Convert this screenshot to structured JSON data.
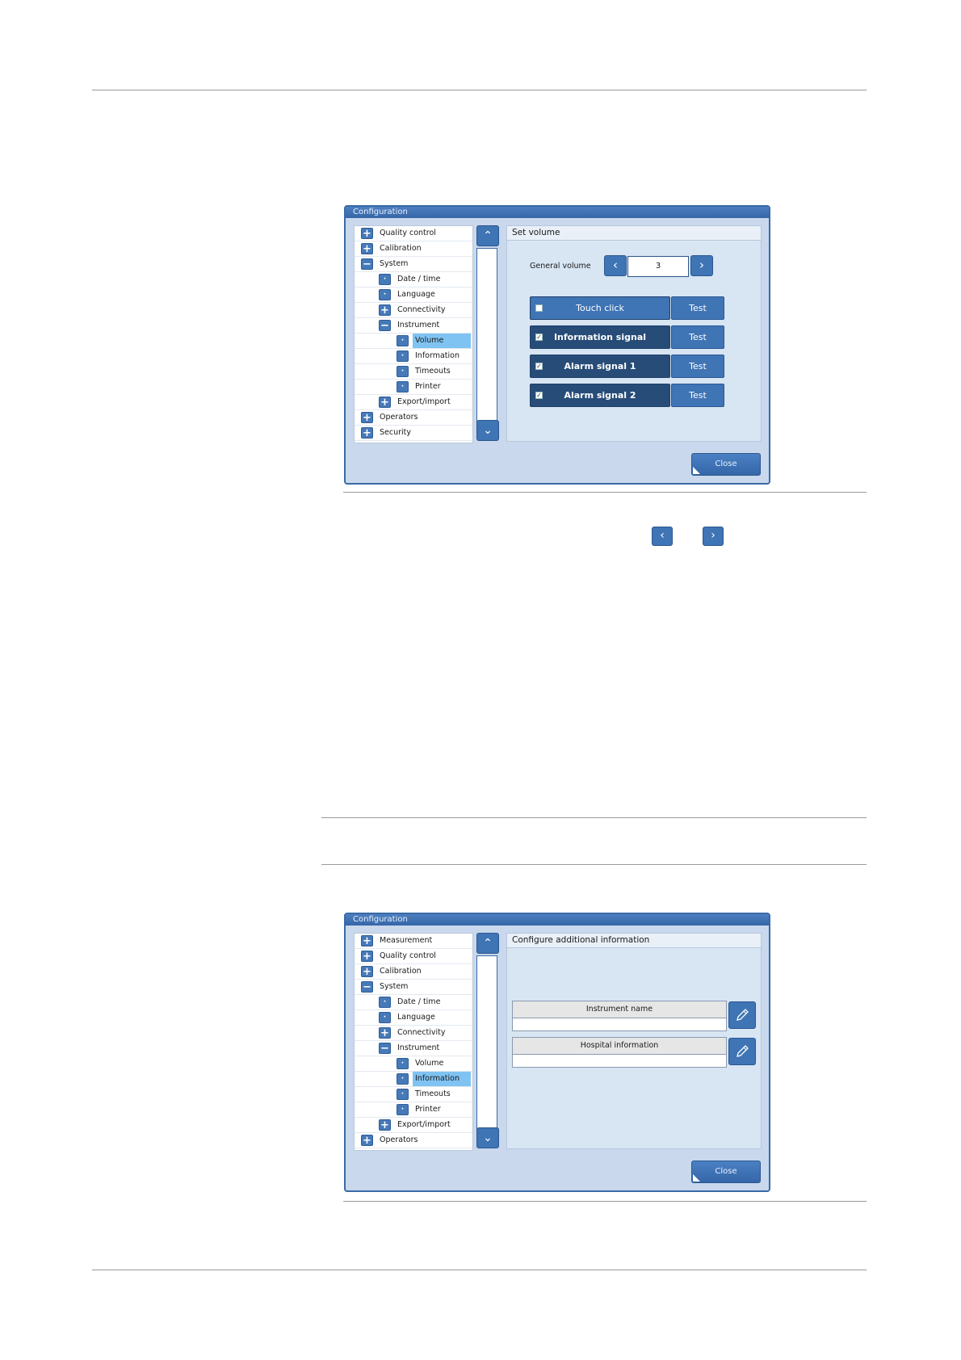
{
  "dialog1": {
    "title": "Configuration",
    "tree": [
      {
        "label": "Quality control",
        "icon": "plus-icon",
        "level": 0,
        "selected": false
      },
      {
        "label": "Calibration",
        "icon": "plus-icon",
        "level": 0,
        "selected": false
      },
      {
        "label": "System",
        "icon": "minus-icon",
        "level": 0,
        "selected": false
      },
      {
        "label": "Date / time",
        "icon": "dot-icon",
        "level": 1,
        "selected": false
      },
      {
        "label": "Language",
        "icon": "dot-icon",
        "level": 1,
        "selected": false
      },
      {
        "label": "Connectivity",
        "icon": "plus-icon",
        "level": 1,
        "selected": false
      },
      {
        "label": "Instrument",
        "icon": "minus-icon",
        "level": 1,
        "selected": false
      },
      {
        "label": "Volume",
        "icon": "dot-icon",
        "level": 2,
        "selected": true
      },
      {
        "label": "Information",
        "icon": "dot-icon",
        "level": 2,
        "selected": false
      },
      {
        "label": "Timeouts",
        "icon": "dot-icon",
        "level": 2,
        "selected": false
      },
      {
        "label": "Printer",
        "icon": "dot-icon",
        "level": 2,
        "selected": false
      },
      {
        "label": "Export/import",
        "icon": "plus-icon",
        "level": 1,
        "selected": false
      },
      {
        "label": "Operators",
        "icon": "plus-icon",
        "level": 0,
        "selected": false
      },
      {
        "label": "Security",
        "icon": "plus-icon",
        "level": 0,
        "selected": false
      }
    ],
    "panel_title": "Set volume",
    "general_volume_label": "General volume",
    "general_volume_value": "3",
    "signals": [
      {
        "label": "Touch click",
        "checked": false,
        "test_label": "Test"
      },
      {
        "label": "Information signal",
        "checked": true,
        "test_label": "Test"
      },
      {
        "label": "Alarm signal 1",
        "checked": true,
        "test_label": "Test"
      },
      {
        "label": "Alarm signal 2",
        "checked": true,
        "test_label": "Test"
      }
    ],
    "close_label": "Close"
  },
  "dialog2": {
    "title": "Configuration",
    "tree": [
      {
        "label": "Measurement",
        "icon": "plus-icon",
        "level": 0,
        "selected": false
      },
      {
        "label": "Quality control",
        "icon": "plus-icon",
        "level": 0,
        "selected": false
      },
      {
        "label": "Calibration",
        "icon": "plus-icon",
        "level": 0,
        "selected": false
      },
      {
        "label": "System",
        "icon": "minus-icon",
        "level": 0,
        "selected": false
      },
      {
        "label": "Date / time",
        "icon": "dot-icon",
        "level": 1,
        "selected": false
      },
      {
        "label": "Language",
        "icon": "dot-icon",
        "level": 1,
        "selected": false
      },
      {
        "label": "Connectivity",
        "icon": "plus-icon",
        "level": 1,
        "selected": false
      },
      {
        "label": "Instrument",
        "icon": "minus-icon",
        "level": 1,
        "selected": false
      },
      {
        "label": "Volume",
        "icon": "dot-icon",
        "level": 2,
        "selected": false
      },
      {
        "label": "Information",
        "icon": "dot-icon",
        "level": 2,
        "selected": true
      },
      {
        "label": "Timeouts",
        "icon": "dot-icon",
        "level": 2,
        "selected": false
      },
      {
        "label": "Printer",
        "icon": "dot-icon",
        "level": 2,
        "selected": false
      },
      {
        "label": "Export/import",
        "icon": "plus-icon",
        "level": 1,
        "selected": false
      },
      {
        "label": "Operators",
        "icon": "plus-icon",
        "level": 0,
        "selected": false
      }
    ],
    "panel_title": "Configure additional information",
    "fields": [
      {
        "label": "Instrument name",
        "value": ""
      },
      {
        "label": "Hospital information",
        "value": ""
      }
    ],
    "close_label": "Close"
  },
  "inline_icons": [
    "chevron-left-icon",
    "chevron-right-icon"
  ]
}
